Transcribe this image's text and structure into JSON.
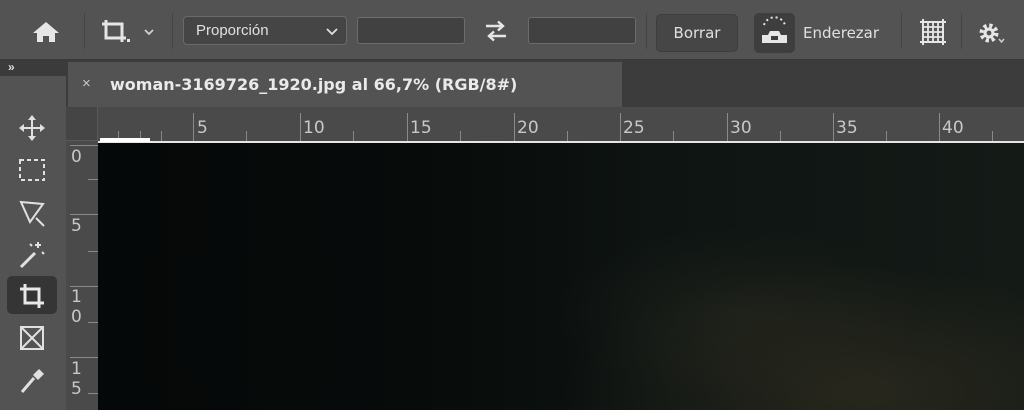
{
  "options_bar": {
    "preset_label": "Proporción",
    "width_value": "",
    "height_value": "",
    "clear_label": "Borrar",
    "straighten_label": "Enderezar",
    "icons": [
      "home-icon",
      "crop-tool-icon",
      "chevron-down-icon",
      "swap-icon",
      "level-icon",
      "grid-overlay-icon",
      "gear-icon"
    ]
  },
  "tools_panel": {
    "collapse_label": "»",
    "tools": [
      "move",
      "marquee",
      "lasso",
      "magic-wand",
      "crop",
      "frame",
      "eyedropper"
    ],
    "active_tool": "crop"
  },
  "document": {
    "tab_close": "×",
    "tab_title": "woman-3169726_1920.jpg al 66,7% (RGB/8#)"
  },
  "rulers": {
    "horizontal_labels": [
      "5",
      "10",
      "15",
      "20",
      "25",
      "30",
      "35",
      "40"
    ],
    "vertical_labels": [
      "0",
      "5",
      "1",
      "0",
      "1",
      "5"
    ]
  },
  "colors": {
    "ui_background": "#535353",
    "tab_bar": "#3c3c3c",
    "canvas_dark": "#070b0a"
  }
}
